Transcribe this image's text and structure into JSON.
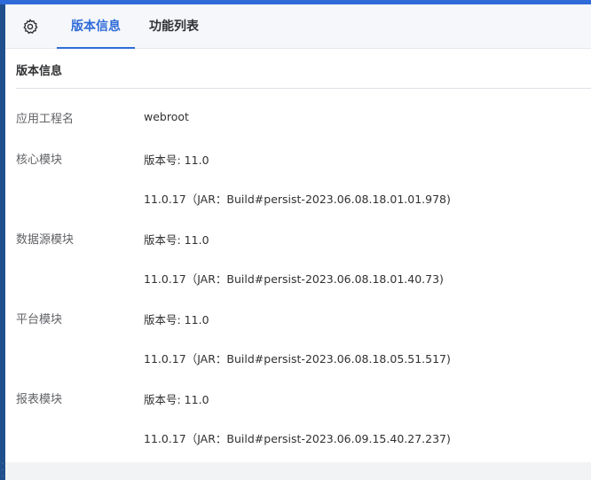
{
  "tabs": {
    "settings_icon": "gear-icon",
    "version_info": "版本信息",
    "feature_list": "功能列表"
  },
  "section": {
    "title": "版本信息"
  },
  "rows": {
    "app": {
      "label": "应用工程名",
      "value": "webroot"
    },
    "core": {
      "label": "核心模块",
      "version": "版本号: 11.0",
      "build": "11.0.17（JAR：Build#persist-2023.06.08.18.01.01.978)"
    },
    "datasource": {
      "label": "数据源模块",
      "version": "版本号: 11.0",
      "build": "11.0.17（JAR：Build#persist-2023.06.08.18.01.40.73)"
    },
    "platform": {
      "label": "平台模块",
      "version": "版本号: 11.0",
      "build": "11.0.17（JAR：Build#persist-2023.06.08.18.05.51.517)"
    },
    "report": {
      "label": "报表模块",
      "version": "版本号: 11.0",
      "build": "11.0.17（JAR：Build#persist-2023.06.09.15.40.27.237)"
    }
  },
  "colors": {
    "accent": "#2f6bd8",
    "sidebar": "#1f4f8c"
  }
}
